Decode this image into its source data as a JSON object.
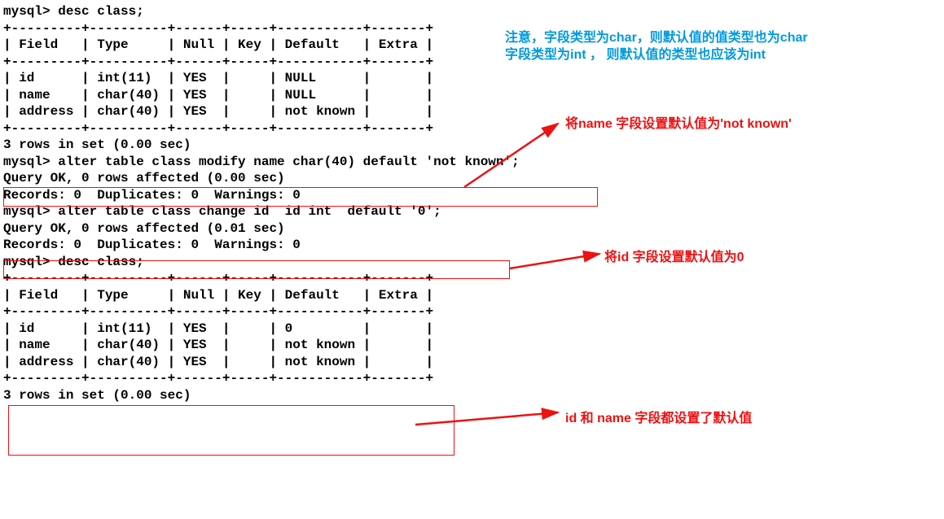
{
  "term": {
    "l1": "mysql> desc class;",
    "l2": "+---------+----------+------+-----+-----------+-------+",
    "l3": "| Field   | Type     | Null | Key | Default   | Extra |",
    "l4": "+---------+----------+------+-----+-----------+-------+",
    "l5": "| id      | int(11)  | YES  |     | NULL      |       |",
    "l6": "| name    | char(40) | YES  |     | NULL      |       |",
    "l7": "| address | char(40) | YES  |     | not known |       |",
    "l8": "+---------+----------+------+-----+-----------+-------+",
    "l9": "3 rows in set (0.00 sec)",
    "l10": "",
    "l11": "mysql> alter table class modify name char(40) default 'not known';",
    "l12": "Query OK, 0 rows affected (0.00 sec)",
    "l13": "Records: 0  Duplicates: 0  Warnings: 0",
    "l14": "",
    "l15": "mysql> alter table class change id  id int  default '0';",
    "l16": "Query OK, 0 rows affected (0.01 sec)",
    "l17": "Records: 0  Duplicates: 0  Warnings: 0",
    "l18": "",
    "l19": "mysql> desc class;",
    "l20": "+---------+----------+------+-----+-----------+-------+",
    "l21": "| Field   | Type     | Null | Key | Default   | Extra |",
    "l22": "+---------+----------+------+-----+-----------+-------+",
    "l23": "| id      | int(11)  | YES  |     | 0         |       |",
    "l24": "| name    | char(40) | YES  |     | not known |       |",
    "l25": "| address | char(40) | YES  |     | not known |       |",
    "l26": "+---------+----------+------+-----+-----------+-------+",
    "l27": "3 rows in set (0.00 sec)"
  },
  "annotations": {
    "blue_l1": "注意，字段类型为char，则默认值的值类型也为char",
    "blue_l2": "字段类型为int ， 则默认值的类型也应该为int",
    "red_name": "将name 字段设置默认值为'not known'",
    "red_id": "将id 字段设置默认值为0",
    "red_both": "id 和 name 字段都设置了默认值"
  }
}
